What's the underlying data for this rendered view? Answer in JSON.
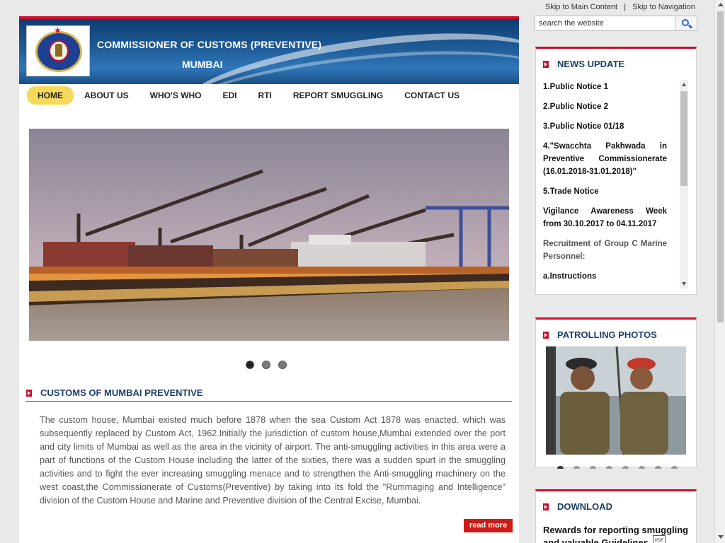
{
  "skip": {
    "main": "Skip to Main Content",
    "sep": "|",
    "nav": "Skip to Navigation"
  },
  "search": {
    "placeholder": "search the website",
    "value": "search the website"
  },
  "header": {
    "title": "COMMISSIONER OF CUSTOMS (PREVENTIVE)",
    "subtitle": "MUMBAI"
  },
  "nav": {
    "items": [
      {
        "label": "HOME"
      },
      {
        "label": "ABOUT US"
      },
      {
        "label": "WHO'S WHO"
      },
      {
        "label": "EDI"
      },
      {
        "label": "RTI"
      },
      {
        "label": "REPORT SMUGGLING"
      },
      {
        "label": "CONTACT US"
      }
    ]
  },
  "slider": {
    "active_slide": 1,
    "slide_count": 3
  },
  "about": {
    "title": "CUSTOMS OF MUMBAI PREVENTIVE",
    "body": "The custom house, Mumbai existed much before 1878 when the sea Custom Act 1878 was enacted. which was subsequently replaced by Custom Act, 1962.Initially the jurisdiction of custom house,Mumbai extended over the port and city limits of Mumbai as well as the area in the vicinity of airport. The anti-smuggling activities in this area were a part of functions of the Custom House including the latter of the sixties, there was a sudden spurt in the smuggling activities and to fight the ever increasing smuggling menace and to strengthen the Anti-smuggling machinery on the west coast,the Commissionerate of Customs(Preventive) by taking into its fold the \"Rummaging and Intelligence\" division of the Custom House and Marine and Preventive division of the Central Excise, Mumbai.",
    "read_more": "read more"
  },
  "news": {
    "title": "NEWS UPDATE",
    "items": [
      "1.Public Notice 1",
      "2.Public Notice 2",
      "3.Public Notice 01/18",
      "4.\"Swacchta Pakhwada in Preventive Commissionerate (16.01.2018-31.01.2018)\"",
      "5.Trade Notice",
      "Vigilance Awareness Week from 30.10.2017 to 04.11.2017",
      "Recruitment of Group C Marine Personnel:",
      "a.Instructions"
    ]
  },
  "patrol": {
    "title": "PATROLLING PHOTOS",
    "active_dot": 1,
    "dot_count": 8
  },
  "download": {
    "title": "DOWNLOAD",
    "item": "Rewards for reporting smuggling and valuable Guidelines",
    "file_type": "PDF"
  },
  "colors": {
    "accent_red": "#c8102e",
    "header_blue": "#1f5c98",
    "nav_active": "#f5d95a",
    "title_blue": "#1d3f66"
  }
}
